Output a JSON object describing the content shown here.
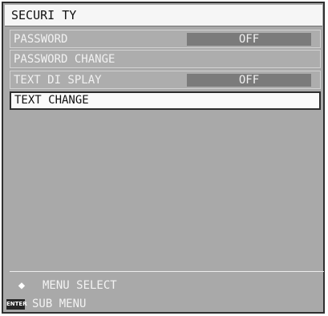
{
  "title": "SECURI TY",
  "menu": [
    {
      "label": "PASSWORD",
      "value": "OFF"
    },
    {
      "label": "PASSWORD CHANGE",
      "value": ""
    },
    {
      "label": "TEXT DI SPLAY",
      "value": "OFF"
    },
    {
      "label": "TEXT CHANGE",
      "value": ""
    }
  ],
  "footer": {
    "hint_1": "MENU SELECT",
    "hint_1_icon": "up-down-arrow-icon",
    "hint_2": "SUB MENU",
    "hint_2_icon_text": "ENTER"
  },
  "colors": {
    "panel": "#a9a9a9",
    "value_box": "#7b7b7b",
    "title_bg": "#f6f6f6",
    "selected_bg": "#fafafa"
  }
}
